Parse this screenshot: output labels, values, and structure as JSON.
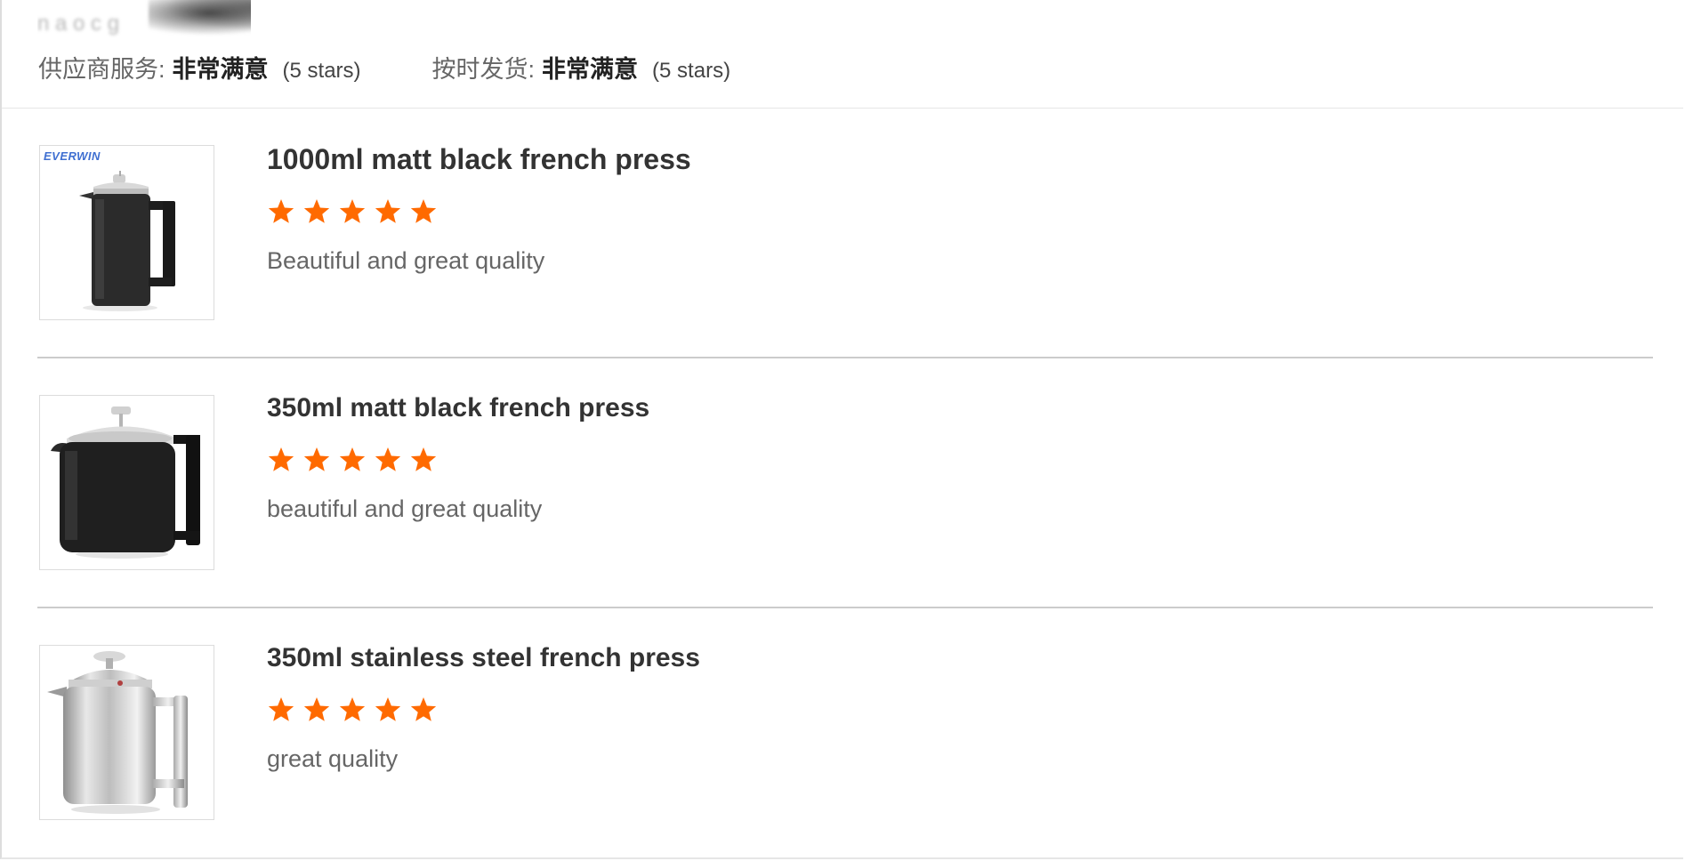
{
  "header": {
    "blurred_text": "n  a o  c   g",
    "ratings": [
      {
        "label": "供应商服务:",
        "value": "非常满意",
        "stars": "(5 stars)"
      },
      {
        "label": "按时发货:",
        "value": "非常满意",
        "stars": "(5 stars)"
      }
    ]
  },
  "reviews": [
    {
      "title": "1000ml matt black french press",
      "rating": 5,
      "comment": "Beautiful and great quality",
      "image": {
        "icon": "black-french-press-tall",
        "brand_text": "EVERWIN",
        "brand_color": "#3f6fd1"
      }
    },
    {
      "title": "350ml matt black french press",
      "rating": 5,
      "comment": "beautiful and great quality",
      "image": {
        "icon": "black-french-press-short"
      }
    },
    {
      "title": "350ml stainless steel french press",
      "rating": 5,
      "comment": "great quality",
      "image": {
        "icon": "steel-french-press"
      }
    }
  ],
  "colors": {
    "star": "#ff6a00",
    "divider": "#cccccc",
    "muted_text": "#666666"
  }
}
